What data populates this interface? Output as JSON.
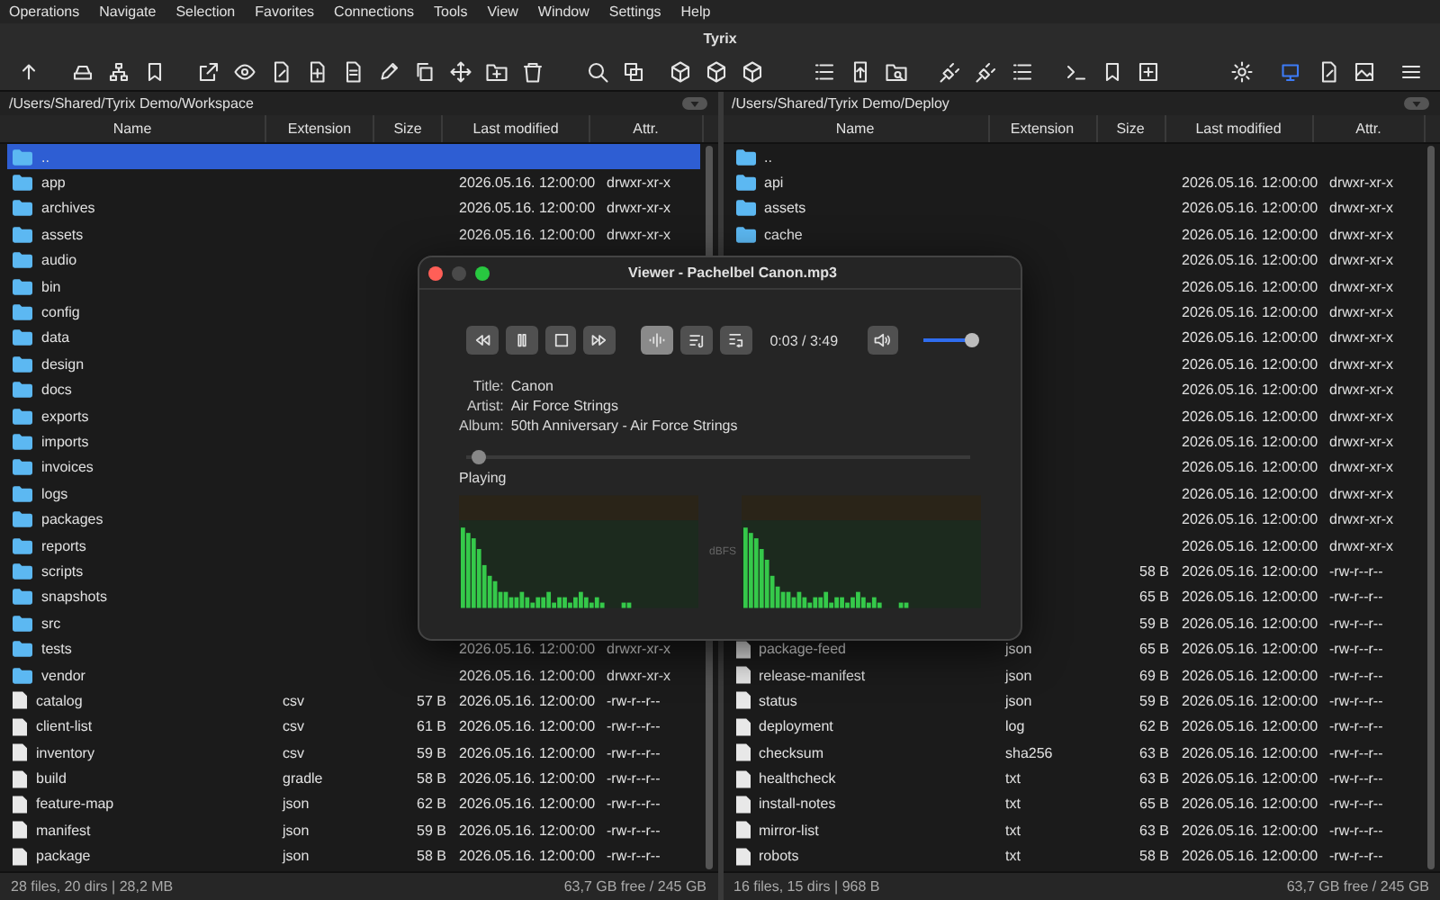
{
  "menu": [
    "Operations",
    "Navigate",
    "Selection",
    "Favorites",
    "Connections",
    "Tools",
    "View",
    "Window",
    "Settings",
    "Help"
  ],
  "window": {
    "title": "Tyrix"
  },
  "toolbar_buttons": [
    {
      "selected": false
    },
    {
      "selected": false
    },
    {
      "selected": false
    },
    {
      "selected": false
    },
    {
      "selected": false
    },
    {
      "selected": false
    },
    {
      "selected": false
    },
    {
      "selected": false
    },
    {
      "selected": false
    },
    {
      "selected": false
    },
    {
      "selected": false
    },
    {
      "selected": false
    },
    {
      "selected": false
    },
    {
      "selected": false
    },
    {
      "selected": false
    },
    {
      "selected": false
    },
    {
      "selected": false
    },
    {
      "selected": false
    },
    {
      "selected": false
    },
    {
      "selected": false
    },
    {
      "selected": false
    },
    {
      "selected": false
    },
    {
      "selected": false
    },
    {
      "selected": false
    },
    {
      "selected": false
    },
    {
      "selected": false
    },
    {
      "selected": false
    },
    {
      "selected": false
    },
    {
      "selected": false
    },
    {
      "selected": true
    },
    {
      "selected": false
    },
    {
      "selected": false
    },
    {
      "selected": false
    }
  ],
  "panels": [
    {
      "path": "/Users/Shared/Tyrix Demo/Workspace",
      "columns": [
        "Name",
        "Extension",
        "Size",
        "Last modified",
        "Attr."
      ],
      "rows": [
        {
          "kind": "dir",
          "name": "..",
          "selected": true
        },
        {
          "kind": "dir",
          "name": "app",
          "modified": "2026.05.16. 12:00:00",
          "attr": "drwxr-xr-x",
          "selected": false
        },
        {
          "kind": "dir",
          "name": "archives",
          "modified": "2026.05.16. 12:00:00",
          "attr": "drwxr-xr-x",
          "selected": false
        },
        {
          "kind": "dir",
          "name": "assets",
          "modified": "2026.05.16. 12:00:00",
          "attr": "drwxr-xr-x",
          "selected": false
        },
        {
          "kind": "dir",
          "name": "audio",
          "selected": false
        },
        {
          "kind": "dir",
          "name": "bin",
          "selected": false
        },
        {
          "kind": "dir",
          "name": "config",
          "selected": false
        },
        {
          "kind": "dir",
          "name": "data",
          "selected": false
        },
        {
          "kind": "dir",
          "name": "design",
          "selected": false
        },
        {
          "kind": "dir",
          "name": "docs",
          "selected": false
        },
        {
          "kind": "dir",
          "name": "exports",
          "selected": false
        },
        {
          "kind": "dir",
          "name": "imports",
          "selected": false
        },
        {
          "kind": "dir",
          "name": "invoices",
          "selected": false
        },
        {
          "kind": "dir",
          "name": "logs",
          "selected": false
        },
        {
          "kind": "dir",
          "name": "packages",
          "selected": false
        },
        {
          "kind": "dir",
          "name": "reports",
          "selected": false
        },
        {
          "kind": "dir",
          "name": "scripts",
          "selected": false
        },
        {
          "kind": "dir",
          "name": "snapshots",
          "selected": false
        },
        {
          "kind": "dir",
          "name": "src",
          "selected": false
        },
        {
          "kind": "dir",
          "name": "tests",
          "modified": "2026.05.16. 12:00:00",
          "attr": "drwxr-xr-x",
          "selected": false
        },
        {
          "kind": "dir",
          "name": "vendor",
          "modified": "2026.05.16. 12:00:00",
          "attr": "drwxr-xr-x",
          "selected": false
        },
        {
          "kind": "file",
          "name": "catalog",
          "ext": "csv",
          "size": "57 B",
          "modified": "2026.05.16. 12:00:00",
          "attr": "-rw-r--r--",
          "selected": false
        },
        {
          "kind": "file",
          "name": "client-list",
          "ext": "csv",
          "size": "61 B",
          "modified": "2026.05.16. 12:00:00",
          "attr": "-rw-r--r--",
          "selected": false
        },
        {
          "kind": "file",
          "name": "inventory",
          "ext": "csv",
          "size": "59 B",
          "modified": "2026.05.16. 12:00:00",
          "attr": "-rw-r--r--",
          "selected": false
        },
        {
          "kind": "file",
          "name": "build",
          "ext": "gradle",
          "size": "58 B",
          "modified": "2026.05.16. 12:00:00",
          "attr": "-rw-r--r--",
          "selected": false
        },
        {
          "kind": "file",
          "name": "feature-map",
          "ext": "json",
          "size": "62 B",
          "modified": "2026.05.16. 12:00:00",
          "attr": "-rw-r--r--",
          "selected": false
        },
        {
          "kind": "file",
          "name": "manifest",
          "ext": "json",
          "size": "59 B",
          "modified": "2026.05.16. 12:00:00",
          "attr": "-rw-r--r--",
          "selected": false
        },
        {
          "kind": "file",
          "name": "package",
          "ext": "json",
          "size": "58 B",
          "modified": "2026.05.16. 12:00:00",
          "attr": "-rw-r--r--",
          "selected": false
        }
      ],
      "status": {
        "summary": "28 files, 20 dirs | 28,2 MB",
        "free": "63,7 GB free / 245 GB"
      }
    },
    {
      "path": "/Users/Shared/Tyrix Demo/Deploy",
      "columns": [
        "Name",
        "Extension",
        "Size",
        "Last modified",
        "Attr."
      ],
      "rows": [
        {
          "kind": "dir",
          "name": "..",
          "selected": false
        },
        {
          "kind": "dir",
          "name": "api",
          "modified": "2026.05.16. 12:00:00",
          "attr": "drwxr-xr-x",
          "selected": false
        },
        {
          "kind": "dir",
          "name": "assets",
          "modified": "2026.05.16. 12:00:00",
          "attr": "drwxr-xr-x",
          "selected": false
        },
        {
          "kind": "dir",
          "name": "cache",
          "modified": "2026.05.16. 12:00:00",
          "attr": "drwxr-xr-x",
          "selected": false
        },
        {
          "modified": "2026.05.16. 12:00:00",
          "attr": "drwxr-xr-x",
          "selected": false
        },
        {
          "modified": "2026.05.16. 12:00:00",
          "attr": "drwxr-xr-x",
          "selected": false
        },
        {
          "modified": "2026.05.16. 12:00:00",
          "attr": "drwxr-xr-x",
          "selected": false
        },
        {
          "modified": "2026.05.16. 12:00:00",
          "attr": "drwxr-xr-x",
          "selected": false
        },
        {
          "modified": "2026.05.16. 12:00:00",
          "attr": "drwxr-xr-x",
          "selected": false
        },
        {
          "modified": "2026.05.16. 12:00:00",
          "attr": "drwxr-xr-x",
          "selected": false
        },
        {
          "modified": "2026.05.16. 12:00:00",
          "attr": "drwxr-xr-x",
          "selected": false
        },
        {
          "modified": "2026.05.16. 12:00:00",
          "attr": "drwxr-xr-x",
          "selected": false
        },
        {
          "modified": "2026.05.16. 12:00:00",
          "attr": "drwxr-xr-x",
          "selected": false
        },
        {
          "modified": "2026.05.16. 12:00:00",
          "attr": "drwxr-xr-x",
          "selected": false
        },
        {
          "modified": "2026.05.16. 12:00:00",
          "attr": "drwxr-xr-x",
          "selected": false
        },
        {
          "modified": "2026.05.16. 12:00:00",
          "attr": "drwxr-xr-x",
          "selected": false
        },
        {
          "size": "58 B",
          "modified": "2026.05.16. 12:00:00",
          "attr": "-rw-r--r--",
          "selected": false
        },
        {
          "size": "65 B",
          "modified": "2026.05.16. 12:00:00",
          "attr": "-rw-r--r--",
          "selected": false
        },
        {
          "size": "59 B",
          "modified": "2026.05.16. 12:00:00",
          "attr": "-rw-r--r--",
          "selected": false
        },
        {
          "kind": "file",
          "name": "package-feed",
          "ext": "json",
          "size": "65 B",
          "modified": "2026.05.16. 12:00:00",
          "attr": "-rw-r--r--",
          "selected": false
        },
        {
          "kind": "file",
          "name": "release-manifest",
          "ext": "json",
          "size": "69 B",
          "modified": "2026.05.16. 12:00:00",
          "attr": "-rw-r--r--",
          "selected": false
        },
        {
          "kind": "file",
          "name": "status",
          "ext": "json",
          "size": "59 B",
          "modified": "2026.05.16. 12:00:00",
          "attr": "-rw-r--r--",
          "selected": false
        },
        {
          "kind": "file",
          "name": "deployment",
          "ext": "log",
          "size": "62 B",
          "modified": "2026.05.16. 12:00:00",
          "attr": "-rw-r--r--",
          "selected": false
        },
        {
          "kind": "file",
          "name": "checksum",
          "ext": "sha256",
          "size": "63 B",
          "modified": "2026.05.16. 12:00:00",
          "attr": "-rw-r--r--",
          "selected": false
        },
        {
          "kind": "file",
          "name": "healthcheck",
          "ext": "txt",
          "size": "63 B",
          "modified": "2026.05.16. 12:00:00",
          "attr": "-rw-r--r--",
          "selected": false
        },
        {
          "kind": "file",
          "name": "install-notes",
          "ext": "txt",
          "size": "65 B",
          "modified": "2026.05.16. 12:00:00",
          "attr": "-rw-r--r--",
          "selected": false
        },
        {
          "kind": "file",
          "name": "mirror-list",
          "ext": "txt",
          "size": "63 B",
          "modified": "2026.05.16. 12:00:00",
          "attr": "-rw-r--r--",
          "selected": false
        },
        {
          "kind": "file",
          "name": "robots",
          "ext": "txt",
          "size": "58 B",
          "modified": "2026.05.16. 12:00:00",
          "attr": "-rw-r--r--",
          "selected": false
        }
      ],
      "status": {
        "summary": "16 files, 15 dirs | 968 B",
        "free": "63,7 GB free / 245 GB"
      }
    }
  ],
  "viewer": {
    "title": "Viewer - Pachelbel Canon.mp3",
    "controls": [
      {
        "selected": false
      },
      {
        "selected": false
      },
      {
        "selected": false
      },
      {
        "selected": false
      },
      {
        "selected": true
      },
      {
        "selected": false
      },
      {
        "selected": false
      }
    ],
    "time": "0:03 / 3:49",
    "volume": {
      "level": 0.85
    },
    "info": [
      {
        "label": "Title:",
        "value": "Canon"
      },
      {
        "label": "Artist:",
        "value": "Air Force Strings"
      },
      {
        "label": "Album:",
        "value": "50th Anniversary - Air Force Strings"
      }
    ],
    "progress": {
      "level": 0.01
    },
    "state": "Playing",
    "meter_label": "dBFS"
  }
}
